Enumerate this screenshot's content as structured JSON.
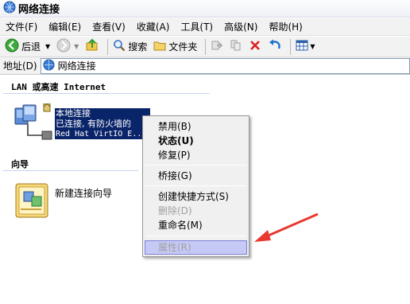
{
  "window": {
    "title": "网络连接",
    "icon": "network-folder-icon"
  },
  "menubar": {
    "items": [
      {
        "label": "文件(F)"
      },
      {
        "label": "编辑(E)"
      },
      {
        "label": "查看(V)"
      },
      {
        "label": "收藏(A)"
      },
      {
        "label": "工具(T)"
      },
      {
        "label": "高级(N)"
      },
      {
        "label": "帮助(H)"
      }
    ]
  },
  "toolbar": {
    "back_label": "后退",
    "search_label": "搜索",
    "folders_label": "文件夹"
  },
  "address": {
    "label": "地址(D)",
    "value": "网络连接"
  },
  "groups": {
    "lan_header": "LAN 或高速 Internet",
    "wizard_header": "向导"
  },
  "connection": {
    "name": "本地连接",
    "status": "已连接, 有防火墙的",
    "device": "Red Hat VirtIO E..."
  },
  "wizard": {
    "label": "新建连接向导"
  },
  "context_menu": {
    "items": {
      "disable": "禁用(B)",
      "status": "状态(U)",
      "repair": "修复(P)",
      "bridge": "桥接(G)",
      "shortcut": "创建快捷方式(S)",
      "delete": "删除(D)",
      "rename": "重命名(M)",
      "properties": "属性(R)"
    },
    "highlighted": "properties"
  },
  "colors": {
    "selection": "#0a246a",
    "menu_highlight": "#c6c9f5",
    "arrow": "#e8392f"
  }
}
